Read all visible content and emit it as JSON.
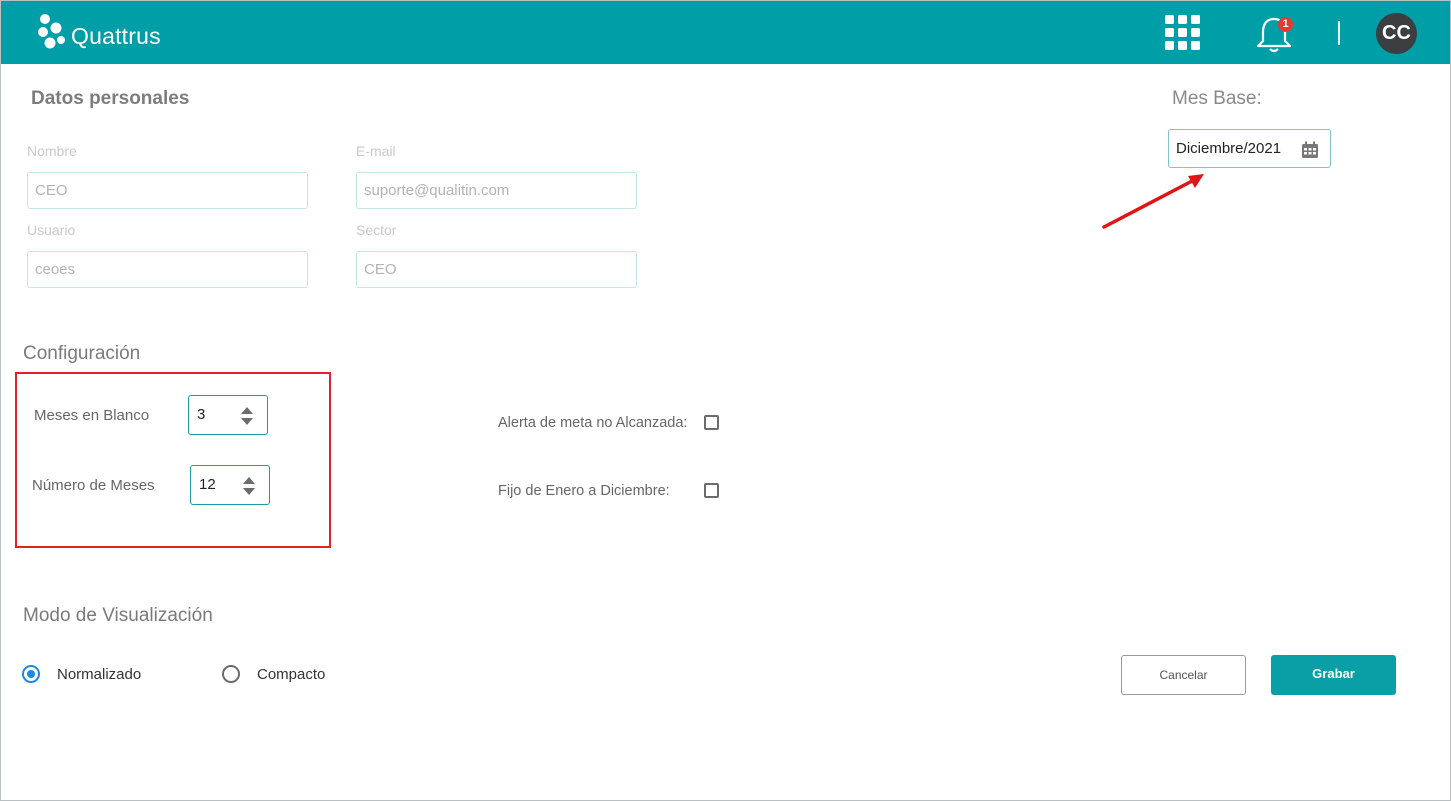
{
  "app": {
    "name": "Quattrus",
    "notifications_count": "1",
    "user_initials": "CC",
    "accent_color": "#009ea6"
  },
  "personal": {
    "title": "Datos personales",
    "nombre_label": "Nombre",
    "nombre_value": "CEO",
    "email_label": "E-mail",
    "email_value": "suporte@qualitin.com",
    "usuario_label": "Usuario",
    "usuario_value": "ceoes",
    "sector_label": "Sector",
    "sector_value": "CEO"
  },
  "mes_base": {
    "title": "Mes Base:",
    "value": "Diciembre/2021"
  },
  "config": {
    "title": "Configuración",
    "meses_blanco_label": "Meses en Blanco",
    "meses_blanco_value": "3",
    "numero_meses_label": "Número de Meses",
    "numero_meses_value": "12",
    "alerta_label": "Alerta de meta no Alcanzada:",
    "alerta_checked": false,
    "fijo_label": "Fijo de Enero a Diciembre:",
    "fijo_checked": false
  },
  "view_mode": {
    "title": "Modo de Visualización",
    "options": [
      "Normalizado",
      "Compacto"
    ],
    "selected": "Normalizado"
  },
  "actions": {
    "cancel_label": "Cancelar",
    "save_label": "Grabar"
  }
}
